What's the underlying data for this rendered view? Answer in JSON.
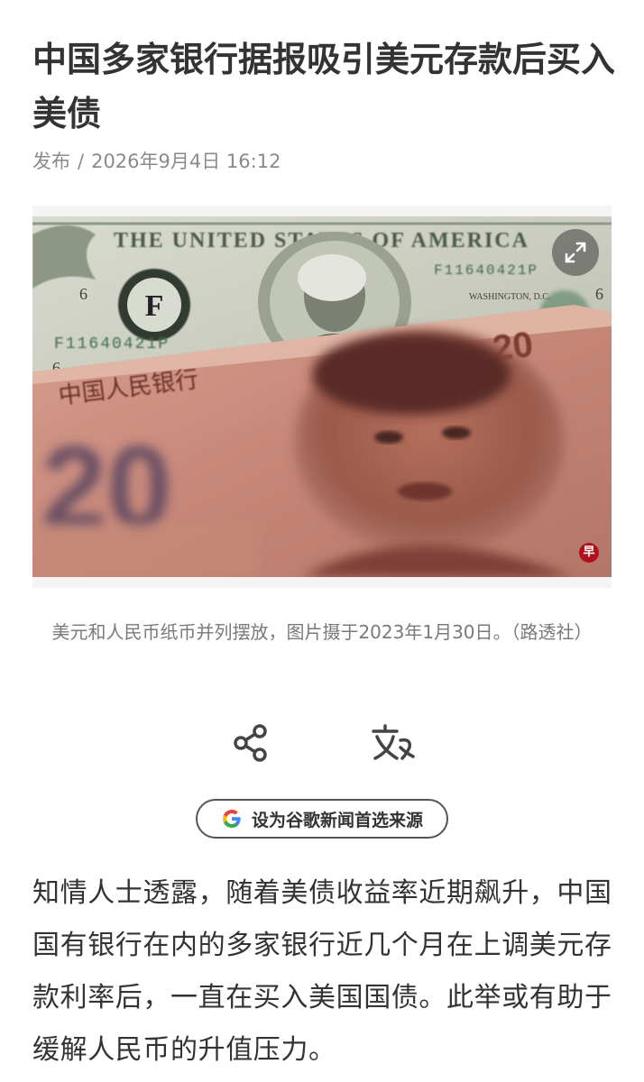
{
  "article": {
    "title": "中国多家银行据报吸引美元存款后买入美债",
    "published_label": "发布",
    "published_separator": "/",
    "published_datetime": "2026年9月4日 16:12",
    "image_caption": "美元和人民币纸币并列摆放，图片摄于2023年1月30日。（路透社）",
    "body": "知情人士透露，随着美债收益率近期飙升，中国国有银行在内的多家银行近几个月在上调美元存款利率后，一直在买入美国国债。此举或有助于缓解人民币的升值压力。"
  },
  "photo": {
    "banknote_header": "THE UNITED STATES OF AMERICA",
    "serial_number": "F11640421P",
    "serial_number_top": "F11640421P",
    "seal_letter": "F",
    "denomination_usd": "6",
    "washington_label": "WASHINGTON, D.C.",
    "rmb_denomination": "20",
    "rmb_bank_text": "中国人民银行",
    "watermark_logo": "早"
  },
  "actions": {
    "share_icon": "share-icon",
    "translate_icon": "translate-icon",
    "expand_icon": "expand-icon"
  },
  "google_pref": {
    "label": "设为谷歌新闻首选来源",
    "icon": "google-g-icon"
  },
  "colors": {
    "title": "#333333",
    "meta": "#8a8a8a",
    "caption": "#7a7a7a",
    "google_blue": "#4285F4",
    "google_red": "#EA4335",
    "google_yellow": "#FBBC05",
    "google_green": "#34A853",
    "watermark_red": "#b0121b"
  }
}
